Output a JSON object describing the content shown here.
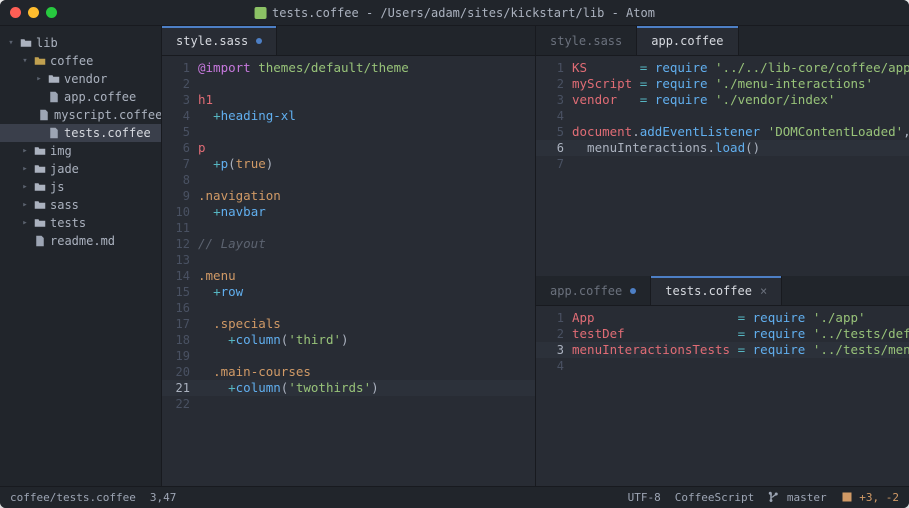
{
  "window": {
    "title": "tests.coffee - /Users/adam/sites/kickstart/lib - Atom"
  },
  "tree": {
    "root": "lib",
    "items": [
      {
        "indent": 0,
        "chev": "▾",
        "icon": "folder",
        "label": "lib"
      },
      {
        "indent": 1,
        "chev": "▾",
        "icon": "folder-yellow",
        "label": "coffee"
      },
      {
        "indent": 2,
        "chev": "▸",
        "icon": "folder",
        "label": "vendor"
      },
      {
        "indent": 2,
        "chev": "",
        "icon": "file",
        "label": "app.coffee"
      },
      {
        "indent": 2,
        "chev": "",
        "icon": "file",
        "label": "myscript.coffee"
      },
      {
        "indent": 2,
        "chev": "",
        "icon": "file",
        "label": "tests.coffee",
        "active": true
      },
      {
        "indent": 1,
        "chev": "▸",
        "icon": "folder",
        "label": "img"
      },
      {
        "indent": 1,
        "chev": "▸",
        "icon": "folder",
        "label": "jade"
      },
      {
        "indent": 1,
        "chev": "▸",
        "icon": "folder",
        "label": "js"
      },
      {
        "indent": 1,
        "chev": "▸",
        "icon": "folder",
        "label": "sass"
      },
      {
        "indent": 1,
        "chev": "▸",
        "icon": "folder",
        "label": "tests"
      },
      {
        "indent": 1,
        "chev": "",
        "icon": "file",
        "label": "readme.md"
      }
    ]
  },
  "leftPane": {
    "tabs": [
      {
        "label": "style.sass",
        "active": true,
        "modified": true
      }
    ],
    "gutterHighlight": 21,
    "code": [
      {
        "tokens": [
          [
            "c-kw",
            "@import"
          ],
          [
            "",
            " "
          ],
          [
            "c-str",
            "themes/default/theme"
          ]
        ]
      },
      {
        "tokens": []
      },
      {
        "tokens": [
          [
            "c-tag",
            "h1"
          ]
        ]
      },
      {
        "tokens": [
          [
            "",
            "  "
          ],
          [
            "c-op",
            "+"
          ],
          [
            "c-fn",
            "heading-xl"
          ]
        ]
      },
      {
        "tokens": []
      },
      {
        "tokens": [
          [
            "c-tag",
            "p"
          ]
        ]
      },
      {
        "tokens": [
          [
            "",
            "  "
          ],
          [
            "c-op",
            "+"
          ],
          [
            "c-fn",
            "p"
          ],
          [
            "c-punc",
            "("
          ],
          [
            "c-const",
            "true"
          ],
          [
            "c-punc",
            ")"
          ]
        ]
      },
      {
        "tokens": []
      },
      {
        "tokens": [
          [
            "c-attr",
            ".navigation"
          ]
        ]
      },
      {
        "tokens": [
          [
            "",
            "  "
          ],
          [
            "c-op",
            "+"
          ],
          [
            "c-fn",
            "navbar"
          ]
        ]
      },
      {
        "tokens": []
      },
      {
        "tokens": [
          [
            "c-cm",
            "// Layout"
          ]
        ]
      },
      {
        "tokens": []
      },
      {
        "tokens": [
          [
            "c-attr",
            ".menu"
          ]
        ]
      },
      {
        "tokens": [
          [
            "",
            "  "
          ],
          [
            "c-op",
            "+"
          ],
          [
            "c-fn",
            "row"
          ]
        ]
      },
      {
        "tokens": []
      },
      {
        "tokens": [
          [
            "",
            "  "
          ],
          [
            "c-attr",
            ".specials"
          ]
        ]
      },
      {
        "tokens": [
          [
            "",
            "    "
          ],
          [
            "c-op",
            "+"
          ],
          [
            "c-fn",
            "column"
          ],
          [
            "c-punc",
            "("
          ],
          [
            "c-str",
            "'third'"
          ],
          [
            "c-punc",
            ")"
          ]
        ]
      },
      {
        "tokens": []
      },
      {
        "tokens": [
          [
            "",
            "  "
          ],
          [
            "c-attr",
            ".main-courses"
          ]
        ]
      },
      {
        "tokens": [
          [
            "",
            "    "
          ],
          [
            "c-op",
            "+"
          ],
          [
            "c-fn",
            "column"
          ],
          [
            "c-punc",
            "("
          ],
          [
            "c-str",
            "'twothirds'"
          ],
          [
            "c-punc",
            ")"
          ]
        ],
        "hl": true
      },
      {
        "tokens": []
      }
    ]
  },
  "rightTop": {
    "tabs": [
      {
        "label": "style.sass",
        "active": false
      },
      {
        "label": "app.coffee",
        "active": true
      }
    ],
    "gutterHighlight": 6,
    "code": [
      {
        "tokens": [
          [
            "c-var",
            "KS"
          ],
          [
            "",
            "       "
          ],
          [
            "c-op",
            "="
          ],
          [
            "",
            " "
          ],
          [
            "c-fn",
            "require"
          ],
          [
            "",
            " "
          ],
          [
            "c-str",
            "'../../lib-core/coffee/app'"
          ]
        ]
      },
      {
        "tokens": [
          [
            "c-var",
            "myScript"
          ],
          [
            "",
            " "
          ],
          [
            "c-op",
            "="
          ],
          [
            "",
            " "
          ],
          [
            "c-fn",
            "require"
          ],
          [
            "",
            " "
          ],
          [
            "c-str",
            "'./menu-interactions'"
          ]
        ]
      },
      {
        "tokens": [
          [
            "c-var",
            "vendor"
          ],
          [
            "",
            "   "
          ],
          [
            "c-op",
            "="
          ],
          [
            "",
            " "
          ],
          [
            "c-fn",
            "require"
          ],
          [
            "",
            " "
          ],
          [
            "c-str",
            "'./vendor/index'"
          ]
        ]
      },
      {
        "tokens": []
      },
      {
        "tokens": [
          [
            "c-var",
            "document"
          ],
          [
            "c-punc",
            "."
          ],
          [
            "c-fn",
            "addEventListener"
          ],
          [
            "",
            " "
          ],
          [
            "c-str",
            "'DOMContentLoaded'"
          ],
          [
            "c-punc",
            ","
          ],
          [
            "",
            " "
          ],
          [
            "c-op",
            "->"
          ]
        ]
      },
      {
        "tokens": [
          [
            "",
            "  "
          ],
          [
            "",
            "menuInteractions"
          ],
          [
            "c-punc",
            "."
          ],
          [
            "c-fn",
            "load"
          ],
          [
            "c-punc",
            "()"
          ]
        ],
        "hl": true
      },
      {
        "tokens": []
      }
    ]
  },
  "rightBottom": {
    "tabs": [
      {
        "label": "app.coffee",
        "active": false,
        "modified": true
      },
      {
        "label": "tests.coffee",
        "active": true,
        "closeable": true
      }
    ],
    "gutterHighlight": 3,
    "code": [
      {
        "tokens": [
          [
            "c-var",
            "App"
          ],
          [
            "",
            "                   "
          ],
          [
            "c-op",
            "="
          ],
          [
            "",
            " "
          ],
          [
            "c-fn",
            "require"
          ],
          [
            "",
            " "
          ],
          [
            "c-str",
            "'./app'"
          ]
        ]
      },
      {
        "tokens": [
          [
            "c-var",
            "testDef"
          ],
          [
            "",
            "               "
          ],
          [
            "c-op",
            "="
          ],
          [
            "",
            " "
          ],
          [
            "c-fn",
            "require"
          ],
          [
            "",
            " "
          ],
          [
            "c-str",
            "'../tests/default'"
          ]
        ]
      },
      {
        "tokens": [
          [
            "c-var",
            "menuInteractionsTests"
          ],
          [
            "",
            " "
          ],
          [
            "c-op",
            "="
          ],
          [
            "",
            " "
          ],
          [
            "c-fn",
            "require"
          ],
          [
            "",
            " "
          ],
          [
            "c-str",
            "'../tests/menu'"
          ]
        ],
        "hl": true
      },
      {
        "tokens": []
      }
    ]
  },
  "statusbar": {
    "path": "coffee/tests.coffee",
    "cursor": "3,47",
    "encoding": "UTF-8",
    "grammar": "CoffeeScript",
    "branch": "master",
    "gitdiff": "+3, -2"
  }
}
